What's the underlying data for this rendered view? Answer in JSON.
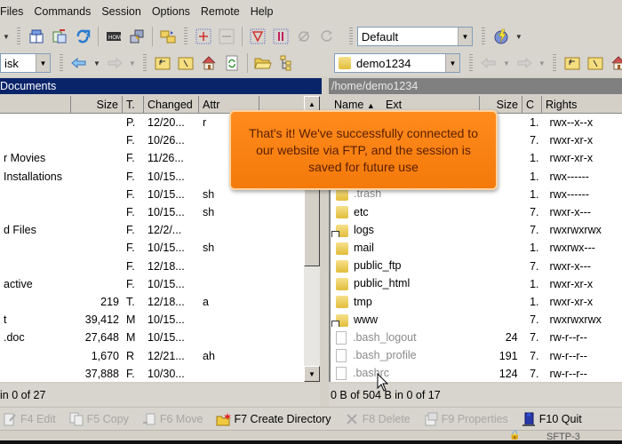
{
  "menu": {
    "items": [
      "Files",
      "Commands",
      "Session",
      "Options",
      "Remote",
      "Help"
    ]
  },
  "toolbar1": {
    "icons": [
      "dropdown-arrow",
      "preferences-icon",
      "synchronize-icon",
      "refresh-icon",
      "console-icon",
      "putty-icon",
      "queue-icon",
      "select-plus-icon",
      "select-minus-icon",
      "filter-icon",
      "invert-icon",
      "clear-filter-icon",
      "reload-icon"
    ],
    "transfer_settings": "Default",
    "session_icon": "globe-lightning-icon"
  },
  "toolbar2_left": {
    "drive": "isk"
  },
  "toolbar2_right": {
    "directory": "demo1234"
  },
  "left_panel": {
    "title": "Documents",
    "columns": [
      "",
      "Size",
      "T.",
      "Changed",
      "Attr"
    ],
    "rows": [
      {
        "name": "",
        "size": "",
        "type": "P.",
        "changed": "12/20...",
        "attr": "r"
      },
      {
        "name": "",
        "size": "",
        "type": "F.",
        "changed": "10/26...",
        "attr": ""
      },
      {
        "name": "r Movies",
        "size": "",
        "type": "F.",
        "changed": "11/26...",
        "attr": ""
      },
      {
        "name": " Installations",
        "size": "",
        "type": "F.",
        "changed": "10/15...",
        "attr": ""
      },
      {
        "name": "",
        "size": "",
        "type": "F.",
        "changed": "10/15...",
        "attr": "sh"
      },
      {
        "name": "",
        "size": "",
        "type": "F.",
        "changed": "10/15...",
        "attr": "sh"
      },
      {
        "name": "d Files",
        "size": "",
        "type": "F.",
        "changed": "12/2/...",
        "attr": ""
      },
      {
        "name": "",
        "size": "",
        "type": "F.",
        "changed": "10/15...",
        "attr": "sh"
      },
      {
        "name": "",
        "size": "",
        "type": "F.",
        "changed": "12/18...",
        "attr": ""
      },
      {
        "name": "active",
        "size": "",
        "type": "F.",
        "changed": "10/15...",
        "attr": ""
      },
      {
        "name": "",
        "size": "219",
        "type": "T.",
        "changed": "12/18...",
        "attr": "a"
      },
      {
        "name": "t",
        "size": "39,412",
        "type": "M",
        "changed": "10/15...",
        "attr": ""
      },
      {
        "name": ".doc",
        "size": "27,648",
        "type": "M",
        "changed": "10/15...",
        "attr": ""
      },
      {
        "name": "",
        "size": "1,670",
        "type": "R",
        "changed": "12/21...",
        "attr": "ah"
      },
      {
        "name": "",
        "size": "37,888",
        "type": "F.",
        "changed": "10/30...",
        "attr": ""
      }
    ],
    "status": "in 0 of 27"
  },
  "right_panel": {
    "title": "/home/demo1234",
    "columns": [
      "Name",
      "Ext",
      "Size",
      "C",
      "Rights"
    ],
    "rows": [
      {
        "name": "",
        "kind": "folder",
        "size": "",
        "c": "1.",
        "rights": "rwx--x--x",
        "hidden": false
      },
      {
        "name": "",
        "kind": "folder",
        "size": "",
        "c": "7.",
        "rights": "rwxr-xr-x",
        "hidden": false
      },
      {
        "name": "",
        "kind": "folder",
        "size": "",
        "c": "1.",
        "rights": "rwxr-xr-x",
        "hidden": false
      },
      {
        "name": "",
        "kind": "folder",
        "size": "",
        "c": "1.",
        "rights": "rwx------",
        "hidden": false
      },
      {
        "name": ".trash",
        "kind": "folder",
        "size": "",
        "c": "1.",
        "rights": "rwx------",
        "hidden": true
      },
      {
        "name": "etc",
        "kind": "folder",
        "size": "",
        "c": "7.",
        "rights": "rwxr-x---",
        "hidden": false
      },
      {
        "name": "logs",
        "kind": "folder-link",
        "size": "",
        "c": "7.",
        "rights": "rwxrwxrwx",
        "hidden": false
      },
      {
        "name": "mail",
        "kind": "folder",
        "size": "",
        "c": "1.",
        "rights": "rwxrwx---",
        "hidden": false
      },
      {
        "name": "public_ftp",
        "kind": "folder",
        "size": "",
        "c": "7.",
        "rights": "rwxr-x---",
        "hidden": false
      },
      {
        "name": "public_html",
        "kind": "folder",
        "size": "",
        "c": "1.",
        "rights": "rwxr-xr-x",
        "hidden": false
      },
      {
        "name": "tmp",
        "kind": "folder",
        "size": "",
        "c": "1.",
        "rights": "rwxr-xr-x",
        "hidden": false
      },
      {
        "name": "www",
        "kind": "folder-link",
        "size": "",
        "c": "7.",
        "rights": "rwxrwxrwx",
        "hidden": false
      },
      {
        "name": ".bash_logout",
        "kind": "file",
        "size": "24",
        "c": "7.",
        "rights": "rw-r--r--",
        "hidden": true
      },
      {
        "name": ".bash_profile",
        "kind": "file",
        "size": "191",
        "c": "7.",
        "rights": "rw-r--r--",
        "hidden": true
      },
      {
        "name": ".bashrc",
        "kind": "file",
        "size": "124",
        "c": "7.",
        "rights": "rw-r--r--",
        "hidden": true
      }
    ],
    "status": "0 B of 504 B in 0 of 17"
  },
  "function_keys": [
    {
      "label": "F4 Edit",
      "icon": "edit-icon",
      "enabled": false
    },
    {
      "label": "F5 Copy",
      "icon": "copy-icon",
      "enabled": false
    },
    {
      "label": "F6 Move",
      "icon": "move-icon",
      "enabled": false
    },
    {
      "label": "F7 Create Directory",
      "icon": "new-folder-icon",
      "enabled": true
    },
    {
      "label": "F8 Delete",
      "icon": "delete-icon",
      "enabled": false
    },
    {
      "label": "F9 Properties",
      "icon": "properties-icon",
      "enabled": false
    },
    {
      "label": "F10 Quit",
      "icon": "quit-icon",
      "enabled": true
    }
  ],
  "bottom_bar": {
    "session_tab": "SFTP-3"
  },
  "callout": {
    "text": "That's it!  We've successfully connected to our website via FTP, and the session is saved for future use"
  }
}
